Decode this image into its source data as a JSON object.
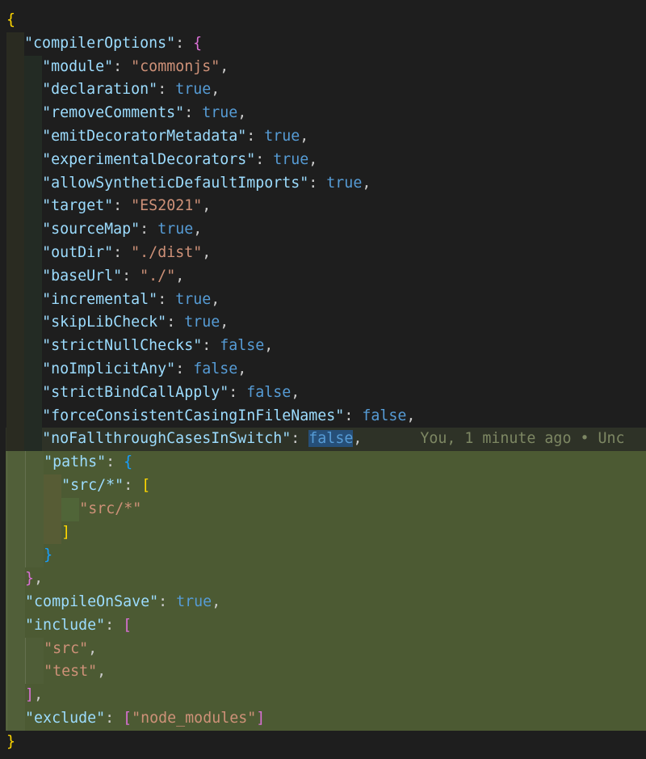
{
  "editor": {
    "colors": {
      "background": "#1e1e1e",
      "change_highlight": "#4c5a33",
      "key": "#9cdcfe",
      "string": "#ce9178",
      "boolean": "#569cd6"
    },
    "blame": "You, 1 minute ago • Unc",
    "lines": [
      {
        "indent": 0,
        "tokens": [
          [
            "b1",
            "{"
          ]
        ]
      },
      {
        "indent": 1,
        "tokens": [
          [
            "key",
            "\"compilerOptions\""
          ],
          [
            "p",
            ": "
          ],
          [
            "b2",
            "{"
          ]
        ]
      },
      {
        "indent": 2,
        "tokens": [
          [
            "key",
            "\"module\""
          ],
          [
            "p",
            ": "
          ],
          [
            "str",
            "\"commonjs\""
          ],
          [
            "p",
            ","
          ]
        ]
      },
      {
        "indent": 2,
        "tokens": [
          [
            "key",
            "\"declaration\""
          ],
          [
            "p",
            ": "
          ],
          [
            "bool",
            "true"
          ],
          [
            "p",
            ","
          ]
        ]
      },
      {
        "indent": 2,
        "tokens": [
          [
            "key",
            "\"removeComments\""
          ],
          [
            "p",
            ": "
          ],
          [
            "bool",
            "true"
          ],
          [
            "p",
            ","
          ]
        ]
      },
      {
        "indent": 2,
        "tokens": [
          [
            "key",
            "\"emitDecoratorMetadata\""
          ],
          [
            "p",
            ": "
          ],
          [
            "bool",
            "true"
          ],
          [
            "p",
            ","
          ]
        ]
      },
      {
        "indent": 2,
        "tokens": [
          [
            "key",
            "\"experimentalDecorators\""
          ],
          [
            "p",
            ": "
          ],
          [
            "bool",
            "true"
          ],
          [
            "p",
            ","
          ]
        ]
      },
      {
        "indent": 2,
        "tokens": [
          [
            "key",
            "\"allowSyntheticDefaultImports\""
          ],
          [
            "p",
            ": "
          ],
          [
            "bool",
            "true"
          ],
          [
            "p",
            ","
          ]
        ]
      },
      {
        "indent": 2,
        "tokens": [
          [
            "key",
            "\"target\""
          ],
          [
            "p",
            ": "
          ],
          [
            "str",
            "\"ES2021\""
          ],
          [
            "p",
            ","
          ]
        ]
      },
      {
        "indent": 2,
        "tokens": [
          [
            "key",
            "\"sourceMap\""
          ],
          [
            "p",
            ": "
          ],
          [
            "bool",
            "true"
          ],
          [
            "p",
            ","
          ]
        ]
      },
      {
        "indent": 2,
        "tokens": [
          [
            "key",
            "\"outDir\""
          ],
          [
            "p",
            ": "
          ],
          [
            "str",
            "\"./dist\""
          ],
          [
            "p",
            ","
          ]
        ]
      },
      {
        "indent": 2,
        "tokens": [
          [
            "key",
            "\"baseUrl\""
          ],
          [
            "p",
            ": "
          ],
          [
            "str",
            "\"./\""
          ],
          [
            "p",
            ","
          ]
        ]
      },
      {
        "indent": 2,
        "tokens": [
          [
            "key",
            "\"incremental\""
          ],
          [
            "p",
            ": "
          ],
          [
            "bool",
            "true"
          ],
          [
            "p",
            ","
          ]
        ]
      },
      {
        "indent": 2,
        "tokens": [
          [
            "key",
            "\"skipLibCheck\""
          ],
          [
            "p",
            ": "
          ],
          [
            "bool",
            "true"
          ],
          [
            "p",
            ","
          ]
        ]
      },
      {
        "indent": 2,
        "tokens": [
          [
            "key",
            "\"strictNullChecks\""
          ],
          [
            "p",
            ": "
          ],
          [
            "bool",
            "false"
          ],
          [
            "p",
            ","
          ]
        ]
      },
      {
        "indent": 2,
        "tokens": [
          [
            "key",
            "\"noImplicitAny\""
          ],
          [
            "p",
            ": "
          ],
          [
            "bool",
            "false"
          ],
          [
            "p",
            ","
          ]
        ]
      },
      {
        "indent": 2,
        "tokens": [
          [
            "key",
            "\"strictBindCallApply\""
          ],
          [
            "p",
            ": "
          ],
          [
            "bool",
            "false"
          ],
          [
            "p",
            ","
          ]
        ]
      },
      {
        "indent": 2,
        "tokens": [
          [
            "key",
            "\"forceConsistentCasingInFileNames\""
          ],
          [
            "p",
            ": "
          ],
          [
            "bool",
            "false"
          ],
          [
            "p",
            ","
          ]
        ]
      },
      {
        "indent": 2,
        "state": "cur",
        "tokens": [
          [
            "key",
            "\"noFallthroughCasesInSwitch\""
          ],
          [
            "p",
            ": "
          ],
          [
            "bool",
            "false"
          ],
          [
            "p",
            ","
          ]
        ],
        "blame": true
      },
      {
        "indent": 2,
        "state": "hl",
        "tokens": [
          [
            "key",
            "\"paths\""
          ],
          [
            "p",
            ": "
          ],
          [
            "b3",
            "{"
          ]
        ]
      },
      {
        "indent": 3,
        "state": "hl",
        "tokens": [
          [
            "key",
            "\"src/*\""
          ],
          [
            "p",
            ": "
          ],
          [
            "b1",
            "["
          ]
        ]
      },
      {
        "indent": 4,
        "state": "hl",
        "tokens": [
          [
            "str",
            "\"src/*\""
          ]
        ]
      },
      {
        "indent": 3,
        "state": "hl",
        "tokens": [
          [
            "b1",
            "]"
          ]
        ]
      },
      {
        "indent": 2,
        "state": "hl",
        "tokens": [
          [
            "b3",
            "}"
          ]
        ]
      },
      {
        "indent": 1,
        "state": "hl",
        "tokens": [
          [
            "b2",
            "}"
          ],
          [
            "p",
            ","
          ]
        ]
      },
      {
        "indent": 1,
        "state": "hl",
        "tokens": [
          [
            "key",
            "\"compileOnSave\""
          ],
          [
            "p",
            ": "
          ],
          [
            "bool",
            "true"
          ],
          [
            "p",
            ","
          ]
        ]
      },
      {
        "indent": 1,
        "state": "hl",
        "tokens": [
          [
            "key",
            "\"include\""
          ],
          [
            "p",
            ": "
          ],
          [
            "b2",
            "["
          ]
        ]
      },
      {
        "indent": 2,
        "state": "hl",
        "tokens": [
          [
            "str",
            "\"src\""
          ],
          [
            "p",
            ","
          ]
        ]
      },
      {
        "indent": 2,
        "state": "hl",
        "tokens": [
          [
            "str",
            "\"test\""
          ],
          [
            "p",
            ","
          ]
        ]
      },
      {
        "indent": 1,
        "state": "hl",
        "tokens": [
          [
            "b2",
            "]"
          ],
          [
            "p",
            ","
          ]
        ]
      },
      {
        "indent": 1,
        "state": "hl",
        "tokens": [
          [
            "key",
            "\"exclude\""
          ],
          [
            "p",
            ": "
          ],
          [
            "b2",
            "["
          ],
          [
            "str",
            "\"node_modules\""
          ],
          [
            "b2",
            "]"
          ]
        ]
      },
      {
        "indent": 0,
        "tokens": [
          [
            "b1",
            "}"
          ]
        ]
      }
    ]
  }
}
